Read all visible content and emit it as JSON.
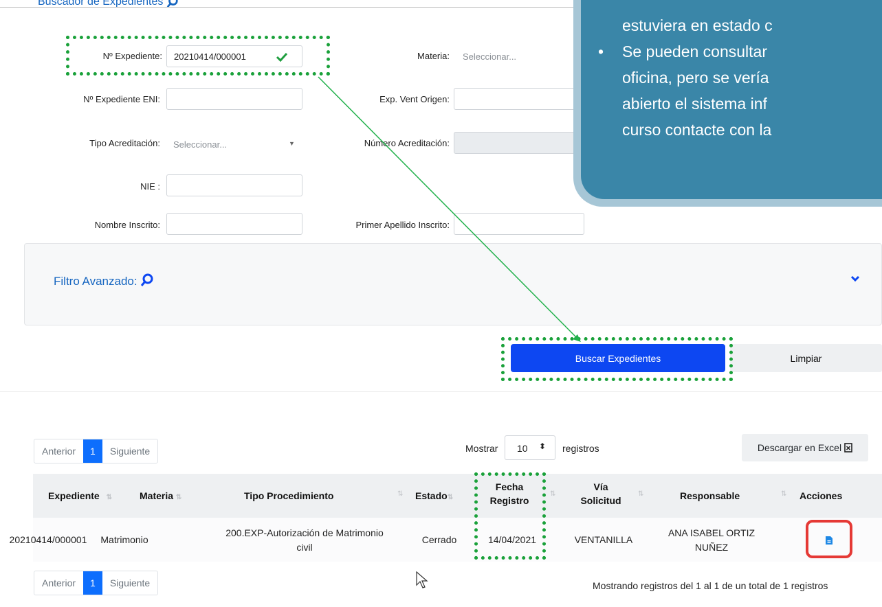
{
  "header": {
    "title": "Buscador de Expedientes"
  },
  "form": {
    "expediente": {
      "label": "Nº Expediente:",
      "value": "20210414/000001"
    },
    "materia": {
      "label": "Materia:",
      "placeholder": "Seleccionar..."
    },
    "expediente_eni": {
      "label": "Nº Expediente ENI:"
    },
    "exp_vent_origen": {
      "label": "Exp. Vent Origen:"
    },
    "tipo_acreditacion": {
      "label": "Tipo Acreditación:",
      "placeholder": "Seleccionar..."
    },
    "numero_acreditacion": {
      "label": "Número Acreditación:"
    },
    "nie": {
      "label": "NIE :"
    },
    "nombre_inscrito": {
      "label": "Nombre Inscrito:"
    },
    "primer_apellido": {
      "label": "Primer Apellido Inscrito:"
    },
    "filtro_avanzado": "Filtro Avanzado:",
    "buscar_button": "Buscar Expedientes",
    "limpiar_button": "Limpiar"
  },
  "callout": {
    "line1": "estuviera en estado c",
    "bullet": "•",
    "line2": "Se pueden consultar",
    "line3": "oficina, pero se vería",
    "line4": "abierto el sistema inf",
    "line5": "curso contacte con la"
  },
  "results": {
    "pager": {
      "prev": "Anterior",
      "page": "1",
      "next": "Siguiente"
    },
    "mostrar_label": "Mostrar",
    "page_size": "10",
    "registros_label": "registros",
    "excel_button": "Descargar en Excel",
    "columns": {
      "expediente": "Expediente",
      "materia": "Materia",
      "tipo": "Tipo Procedimiento",
      "estado": "Estado",
      "fecha_1": "Fecha",
      "fecha_2": "Registro",
      "via_1": "Vía",
      "via_2": "Solicitud",
      "responsable": "Responsable",
      "acciones": "Acciones"
    },
    "row": {
      "expediente": "20210414/000001",
      "materia": "Matrimonio",
      "tipo_1": "200.EXP-Autorización de Matrimonio",
      "tipo_2": "civil",
      "estado": "Cerrado",
      "fecha": "14/04/2021",
      "via": "VENTANILLA",
      "responsable_1": "ANA ISABEL ORTIZ",
      "responsable_2": "NUÑEZ"
    },
    "summary": "Mostrando registros del 1 al 1 de un total de 1 registros"
  },
  "colors": {
    "primary": "#0d47f2",
    "highlight_green": "#1aa13a",
    "highlight_red": "#e53935",
    "callout": "#3a86a8"
  }
}
